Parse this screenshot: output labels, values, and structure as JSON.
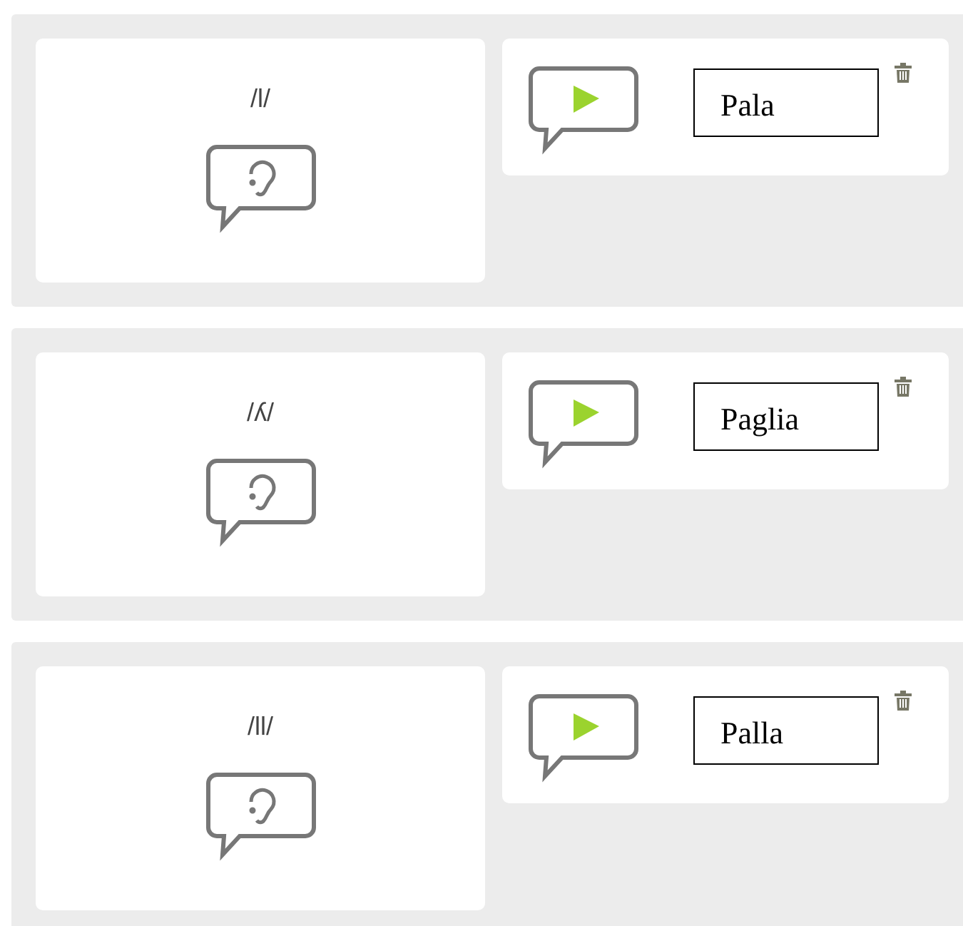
{
  "items": [
    {
      "phoneme": "/l/",
      "word": "Pala"
    },
    {
      "phoneme": "/ʎ/",
      "word": "Paglia"
    },
    {
      "phoneme": "/ll/",
      "word": "Palla"
    }
  ]
}
